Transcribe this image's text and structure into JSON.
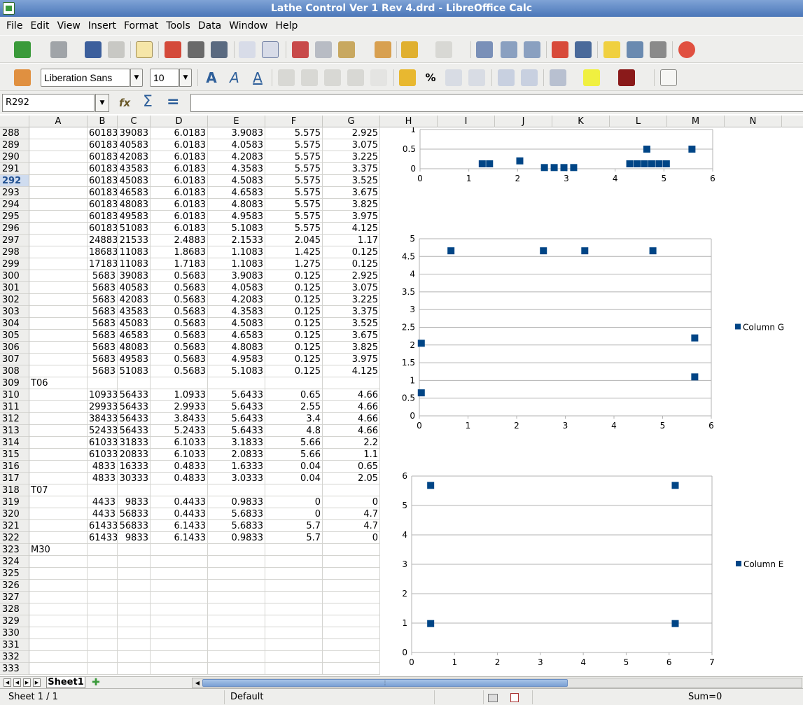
{
  "window": {
    "title": "Lathe Control Ver 1 Rev 4.drd - LibreOffice Calc"
  },
  "menu": [
    "File",
    "Edit",
    "View",
    "Insert",
    "Format",
    "Tools",
    "Data",
    "Window",
    "Help"
  ],
  "format_toolbar": {
    "font_name": "Liberation Sans",
    "font_size": "10"
  },
  "formula_bar": {
    "cell_ref": "R292",
    "formula": ""
  },
  "columns": [
    "A",
    "B",
    "C",
    "D",
    "E",
    "F",
    "G",
    "H",
    "I",
    "J",
    "K",
    "L",
    "M",
    "N"
  ],
  "selected_row": "292",
  "rows": [
    {
      "n": "288",
      "a": "",
      "b": "60183",
      "c": "39083",
      "d": "6.0183",
      "e": "3.9083",
      "f": "5.575",
      "g": "2.925"
    },
    {
      "n": "289",
      "a": "",
      "b": "60183",
      "c": "40583",
      "d": "6.0183",
      "e": "4.0583",
      "f": "5.575",
      "g": "3.075"
    },
    {
      "n": "290",
      "a": "",
      "b": "60183",
      "c": "42083",
      "d": "6.0183",
      "e": "4.2083",
      "f": "5.575",
      "g": "3.225"
    },
    {
      "n": "291",
      "a": "",
      "b": "60183",
      "c": "43583",
      "d": "6.0183",
      "e": "4.3583",
      "f": "5.575",
      "g": "3.375"
    },
    {
      "n": "292",
      "a": "",
      "b": "60183",
      "c": "45083",
      "d": "6.0183",
      "e": "4.5083",
      "f": "5.575",
      "g": "3.525"
    },
    {
      "n": "293",
      "a": "",
      "b": "60183",
      "c": "46583",
      "d": "6.0183",
      "e": "4.6583",
      "f": "5.575",
      "g": "3.675"
    },
    {
      "n": "294",
      "a": "",
      "b": "60183",
      "c": "48083",
      "d": "6.0183",
      "e": "4.8083",
      "f": "5.575",
      "g": "3.825"
    },
    {
      "n": "295",
      "a": "",
      "b": "60183",
      "c": "49583",
      "d": "6.0183",
      "e": "4.9583",
      "f": "5.575",
      "g": "3.975"
    },
    {
      "n": "296",
      "a": "",
      "b": "60183",
      "c": "51083",
      "d": "6.0183",
      "e": "5.1083",
      "f": "5.575",
      "g": "4.125"
    },
    {
      "n": "297",
      "a": "",
      "b": "24883",
      "c": "21533",
      "d": "2.4883",
      "e": "2.1533",
      "f": "2.045",
      "g": "1.17"
    },
    {
      "n": "298",
      "a": "",
      "b": "18683",
      "c": "11083",
      "d": "1.8683",
      "e": "1.1083",
      "f": "1.425",
      "g": "0.125"
    },
    {
      "n": "299",
      "a": "",
      "b": "17183",
      "c": "11083",
      "d": "1.7183",
      "e": "1.1083",
      "f": "1.275",
      "g": "0.125"
    },
    {
      "n": "300",
      "a": "",
      "b": "5683",
      "c": "39083",
      "d": "0.5683",
      "e": "3.9083",
      "f": "0.125",
      "g": "2.925"
    },
    {
      "n": "301",
      "a": "",
      "b": "5683",
      "c": "40583",
      "d": "0.5683",
      "e": "4.0583",
      "f": "0.125",
      "g": "3.075"
    },
    {
      "n": "302",
      "a": "",
      "b": "5683",
      "c": "42083",
      "d": "0.5683",
      "e": "4.2083",
      "f": "0.125",
      "g": "3.225"
    },
    {
      "n": "303",
      "a": "",
      "b": "5683",
      "c": "43583",
      "d": "0.5683",
      "e": "4.3583",
      "f": "0.125",
      "g": "3.375"
    },
    {
      "n": "304",
      "a": "",
      "b": "5683",
      "c": "45083",
      "d": "0.5683",
      "e": "4.5083",
      "f": "0.125",
      "g": "3.525"
    },
    {
      "n": "305",
      "a": "",
      "b": "5683",
      "c": "46583",
      "d": "0.5683",
      "e": "4.6583",
      "f": "0.125",
      "g": "3.675"
    },
    {
      "n": "306",
      "a": "",
      "b": "5683",
      "c": "48083",
      "d": "0.5683",
      "e": "4.8083",
      "f": "0.125",
      "g": "3.825"
    },
    {
      "n": "307",
      "a": "",
      "b": "5683",
      "c": "49583",
      "d": "0.5683",
      "e": "4.9583",
      "f": "0.125",
      "g": "3.975"
    },
    {
      "n": "308",
      "a": "",
      "b": "5683",
      "c": "51083",
      "d": "0.5683",
      "e": "5.1083",
      "f": "0.125",
      "g": "4.125"
    },
    {
      "n": "309",
      "a": "T06",
      "b": "",
      "c": "",
      "d": "",
      "e": "",
      "f": "",
      "g": ""
    },
    {
      "n": "310",
      "a": "",
      "b": "10933",
      "c": "56433",
      "d": "1.0933",
      "e": "5.6433",
      "f": "0.65",
      "g": "4.66"
    },
    {
      "n": "311",
      "a": "",
      "b": "29933",
      "c": "56433",
      "d": "2.9933",
      "e": "5.6433",
      "f": "2.55",
      "g": "4.66"
    },
    {
      "n": "312",
      "a": "",
      "b": "38433",
      "c": "56433",
      "d": "3.8433",
      "e": "5.6433",
      "f": "3.4",
      "g": "4.66"
    },
    {
      "n": "313",
      "a": "",
      "b": "52433",
      "c": "56433",
      "d": "5.2433",
      "e": "5.6433",
      "f": "4.8",
      "g": "4.66"
    },
    {
      "n": "314",
      "a": "",
      "b": "61033",
      "c": "31833",
      "d": "6.1033",
      "e": "3.1833",
      "f": "5.66",
      "g": "2.2"
    },
    {
      "n": "315",
      "a": "",
      "b": "61033",
      "c": "20833",
      "d": "6.1033",
      "e": "2.0833",
      "f": "5.66",
      "g": "1.1"
    },
    {
      "n": "316",
      "a": "",
      "b": "4833",
      "c": "16333",
      "d": "0.4833",
      "e": "1.6333",
      "f": "0.04",
      "g": "0.65"
    },
    {
      "n": "317",
      "a": "",
      "b": "4833",
      "c": "30333",
      "d": "0.4833",
      "e": "3.0333",
      "f": "0.04",
      "g": "2.05"
    },
    {
      "n": "318",
      "a": "T07",
      "b": "",
      "c": "",
      "d": "",
      "e": "",
      "f": "",
      "g": ""
    },
    {
      "n": "319",
      "a": "",
      "b": "4433",
      "c": "9833",
      "d": "0.4433",
      "e": "0.9833",
      "f": "0",
      "g": "0"
    },
    {
      "n": "320",
      "a": "",
      "b": "4433",
      "c": "56833",
      "d": "0.4433",
      "e": "5.6833",
      "f": "0",
      "g": "4.7"
    },
    {
      "n": "321",
      "a": "",
      "b": "61433",
      "c": "56833",
      "d": "6.1433",
      "e": "5.6833",
      "f": "5.7",
      "g": "4.7"
    },
    {
      "n": "322",
      "a": "",
      "b": "61433",
      "c": "9833",
      "d": "6.1433",
      "e": "0.9833",
      "f": "5.7",
      "g": "0"
    },
    {
      "n": "323",
      "a": "M30",
      "b": "",
      "c": "",
      "d": "",
      "e": "",
      "f": "",
      "g": ""
    },
    {
      "n": "324",
      "a": "",
      "b": "",
      "c": "",
      "d": "",
      "e": "",
      "f": "",
      "g": ""
    },
    {
      "n": "325",
      "a": "",
      "b": "",
      "c": "",
      "d": "",
      "e": "",
      "f": "",
      "g": ""
    },
    {
      "n": "326",
      "a": "",
      "b": "",
      "c": "",
      "d": "",
      "e": "",
      "f": "",
      "g": ""
    },
    {
      "n": "327",
      "a": "",
      "b": "",
      "c": "",
      "d": "",
      "e": "",
      "f": "",
      "g": ""
    },
    {
      "n": "328",
      "a": "",
      "b": "",
      "c": "",
      "d": "",
      "e": "",
      "f": "",
      "g": ""
    },
    {
      "n": "329",
      "a": "",
      "b": "",
      "c": "",
      "d": "",
      "e": "",
      "f": "",
      "g": ""
    },
    {
      "n": "330",
      "a": "",
      "b": "",
      "c": "",
      "d": "",
      "e": "",
      "f": "",
      "g": ""
    },
    {
      "n": "331",
      "a": "",
      "b": "",
      "c": "",
      "d": "",
      "e": "",
      "f": "",
      "g": ""
    },
    {
      "n": "332",
      "a": "",
      "b": "",
      "c": "",
      "d": "",
      "e": "",
      "f": "",
      "g": ""
    },
    {
      "n": "333",
      "a": "",
      "b": "",
      "c": "",
      "d": "",
      "e": "",
      "f": "",
      "g": ""
    }
  ],
  "sheet_tabs": [
    "Sheet1"
  ],
  "status": {
    "sheet": "Sheet 1 / 1",
    "style": "Default",
    "sum": "Sum=0"
  },
  "colors": {
    "marker": "#004586"
  },
  "chart_data": [
    {
      "type": "scatter",
      "xlim": [
        0,
        6
      ],
      "ylim": [
        0,
        1
      ],
      "xticks": [
        "0",
        "1",
        "2",
        "3",
        "4",
        "5",
        "6"
      ],
      "yticks": [
        "0",
        "0.5",
        "1"
      ],
      "grid": true,
      "series": [
        {
          "values": [
            [
              1.275,
              0.125
            ],
            [
              1.425,
              0.125
            ],
            [
              2.045,
              0.2
            ],
            [
              2.55,
              0.03
            ],
            [
              2.75,
              0.03
            ],
            [
              2.95,
              0.03
            ],
            [
              3.15,
              0.03
            ],
            [
              4.3,
              0.125
            ],
            [
              4.45,
              0.125
            ],
            [
              4.6,
              0.125
            ],
            [
              4.75,
              0.125
            ],
            [
              4.9,
              0.125
            ],
            [
              5.05,
              0.125
            ],
            [
              4.65,
              0.5
            ],
            [
              5.575,
              0.5
            ]
          ]
        }
      ]
    },
    {
      "type": "scatter",
      "xlim": [
        0,
        6
      ],
      "ylim": [
        0,
        5
      ],
      "xticks": [
        "0",
        "1",
        "2",
        "3",
        "4",
        "5",
        "6"
      ],
      "yticks": [
        "0",
        "0.5",
        "1",
        "1.5",
        "2",
        "2.5",
        "3",
        "3.5",
        "4",
        "4.5",
        "5"
      ],
      "grid": true,
      "legend": "right",
      "series": [
        {
          "name": "Column G",
          "values": [
            [
              0.04,
              2.05
            ],
            [
              0.04,
              0.65
            ],
            [
              0.65,
              4.66
            ],
            [
              2.55,
              4.66
            ],
            [
              3.4,
              4.66
            ],
            [
              4.8,
              4.66
            ],
            [
              5.66,
              2.2
            ],
            [
              5.66,
              1.1
            ]
          ]
        }
      ]
    },
    {
      "type": "scatter",
      "xlim": [
        0,
        7
      ],
      "ylim": [
        0,
        6
      ],
      "xticks": [
        "0",
        "1",
        "2",
        "3",
        "4",
        "5",
        "6",
        "7"
      ],
      "yticks": [
        "0",
        "1",
        "2",
        "3",
        "4",
        "5",
        "6"
      ],
      "grid": true,
      "legend": "right",
      "series": [
        {
          "name": "Column E",
          "values": [
            [
              0.4433,
              5.6833
            ],
            [
              0.4433,
              0.9833
            ],
            [
              6.1433,
              5.6833
            ],
            [
              6.1433,
              0.9833
            ]
          ]
        }
      ]
    }
  ]
}
